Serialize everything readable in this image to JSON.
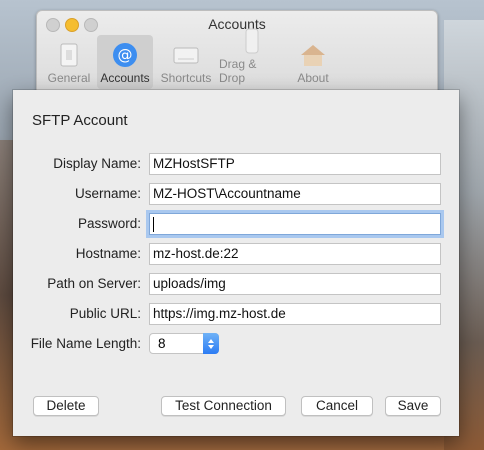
{
  "preferences": {
    "title": "Accounts",
    "tabs": [
      {
        "label": "General",
        "icon": "general-icon"
      },
      {
        "label": "Accounts",
        "icon": "at-icon",
        "active": true
      },
      {
        "label": "Shortcuts",
        "icon": "keyboard-icon"
      },
      {
        "label": "Drag & Drop",
        "icon": "drag-drop-icon"
      },
      {
        "label": "About",
        "icon": "about-icon"
      }
    ]
  },
  "sheet": {
    "title": "SFTP Account",
    "fields": {
      "display_name": {
        "label": "Display Name:",
        "value": "MZHostSFTP"
      },
      "username": {
        "label": "Username:",
        "value": "MZ-HOST\\Accountname"
      },
      "password": {
        "label": "Password:",
        "value": ""
      },
      "hostname": {
        "label": "Hostname:",
        "value": "mz-host.de:22"
      },
      "path": {
        "label": "Path on Server:",
        "value": "uploads/img"
      },
      "public_url": {
        "label": "Public URL:",
        "value": "https://img.mz-host.de"
      },
      "file_name_length": {
        "label": "File Name Length:",
        "value": "8"
      }
    },
    "buttons": {
      "delete": "Delete",
      "test": "Test Connection",
      "cancel": "Cancel",
      "save": "Save"
    }
  },
  "colors": {
    "accent": "#2c7cf4",
    "focus_ring": "#a9c8ef",
    "minimize": "#f5bd2f"
  }
}
